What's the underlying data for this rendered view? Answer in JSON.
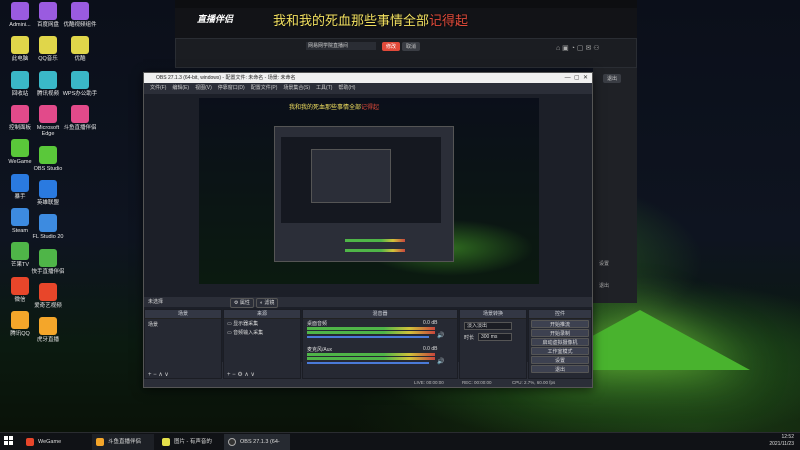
{
  "desktop": {
    "icons_col1": [
      "Admini...",
      "此电脑",
      "回收站",
      "控制面板",
      "WeGame",
      "暴手",
      "Steam",
      "芒果TV",
      "微信",
      "腾讯QQ"
    ],
    "icons_col2": [
      "百度网盘",
      "QQ音乐",
      "腾讯视频",
      "Microsoft Edge",
      "OBS Studio",
      "英雄联盟",
      "FL Studio 20",
      "快手直播伴侣",
      "爱奇艺视频",
      "虎牙直播"
    ],
    "icons_col3": [
      "优酷视频组件",
      "优酷",
      "WPS办公助手",
      "斗鱼直播伴侣"
    ]
  },
  "douyu_window": {
    "logo": "直播伴侣",
    "title_overlay": "我和我的死血那些事情全部",
    "title_highlight": "记得起",
    "room_title_value": "网易网学院直播间",
    "btn_modify": "修改",
    "btn_cancel": "取消",
    "side_button": "退出",
    "side_labels": [
      "设置",
      "退出"
    ]
  },
  "obs": {
    "title": "OBS 27.1.3 (64-bit, windows) - 配置文件: 未命名 - 场景: 未命名",
    "menu": [
      "文件(F)",
      "编辑(E)",
      "视图(V)",
      "停靠窗口(D)",
      "配置文件(P)",
      "场景集合(S)",
      "工具(T)",
      "帮助(H)"
    ],
    "source_bar": {
      "no_source": "未选择",
      "properties": "属性",
      "filters": "滤镜"
    },
    "docks": {
      "scenes": {
        "title": "场景",
        "items": [
          "场景"
        ]
      },
      "sources": {
        "title": "来源",
        "items": [
          "显示器采集",
          "音频输入采集"
        ]
      },
      "mixer": {
        "title": "混音器",
        "tracks": [
          {
            "name": "桌面音频",
            "level": "0.0 dB"
          },
          {
            "name": "麦克风/Aux",
            "level": "0.0 dB"
          }
        ]
      },
      "transitions": {
        "title": "场景转换",
        "type": "淡入淡出",
        "duration_label": "时长",
        "duration_value": "300 ms"
      },
      "controls": {
        "title": "控件",
        "buttons": [
          "开始推流",
          "开始录制",
          "启动虚拟摄像机",
          "工作室模式",
          "设置",
          "退出"
        ]
      }
    },
    "status": {
      "live": "LIVE: 00:00:00",
      "rec": "REC: 00:00:00",
      "cpu": "CPU: 2.7%, 60.00 fps"
    }
  },
  "taskbar": {
    "items": [
      "WeGame",
      "斗鱼直播伴侣",
      "图片 - 有声音的Br...",
      "OBS 27.1.3 (64-bit)..."
    ],
    "clock_time": "12:52",
    "clock_date": "2021/11/23"
  },
  "colors": {
    "obs_bg": "#2b2e38",
    "accent_yellow": "#e0d64a",
    "accent_red": "#e24a3a",
    "tent_green": "#49b32e"
  }
}
